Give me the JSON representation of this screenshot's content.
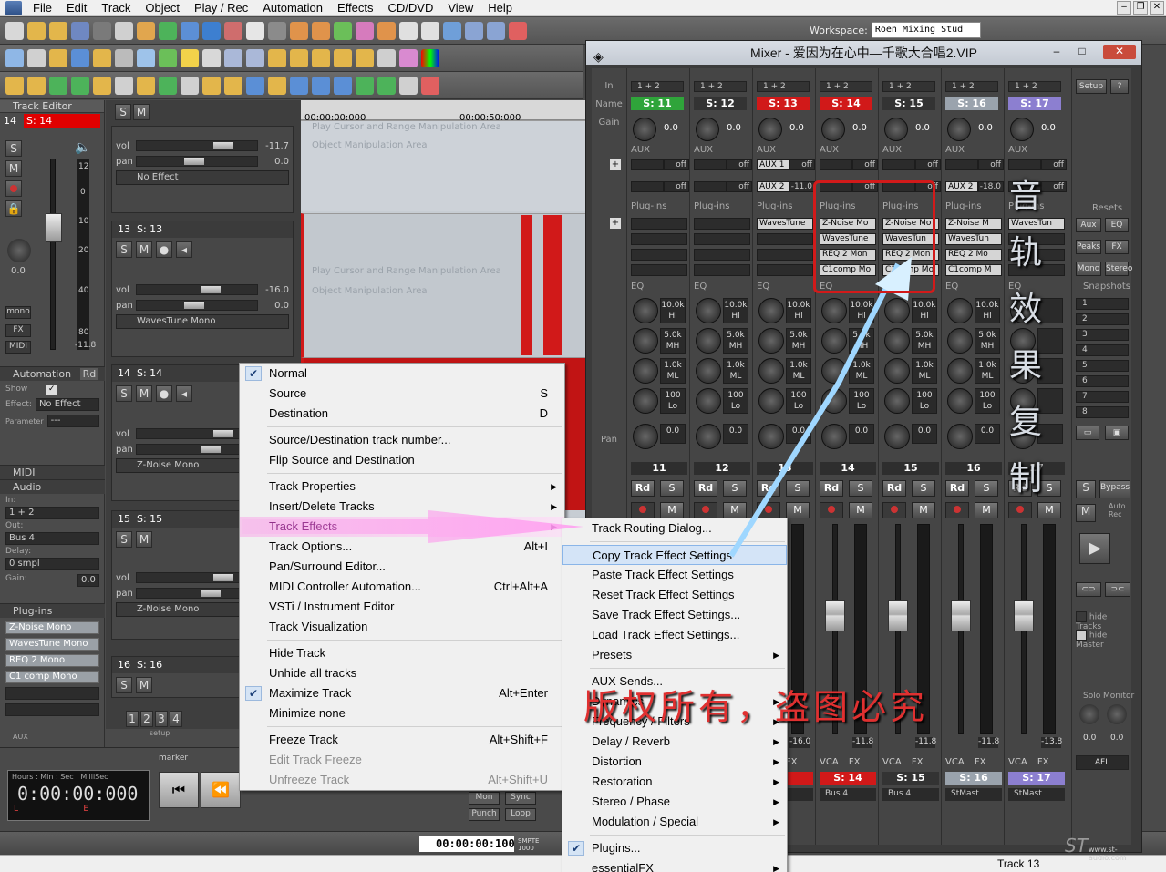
{
  "menubar": [
    "File",
    "Edit",
    "Track",
    "Object",
    "Play / Rec",
    "Automation",
    "Effects",
    "CD/DVD",
    "View",
    "Help"
  ],
  "workspace": {
    "label": "Workspace:",
    "value": "Roen Mixing Stud"
  },
  "track_editor": {
    "title": "Track Editor",
    "track_num": "14",
    "track_name": "S: 14",
    "meter_ticks": [
      "12",
      "0",
      "10",
      "20",
      "40",
      "80",
      "-11.8"
    ],
    "pan_val": "0.0",
    "buttons": {
      "mono": "mono",
      "fx": "FX",
      "midi": "MIDI"
    },
    "automation": {
      "title": "Automation",
      "rd": "Rd",
      "show": "Show",
      "effect_label": "Effect:",
      "effect_value": "No Effect",
      "param_label": "Parameter",
      "param_value": "---"
    },
    "midi": "MIDI",
    "audio": {
      "title": "Audio",
      "in_label": "In:",
      "in_value": "1 + 2",
      "out_label": "Out:",
      "out_value": "Bus 4",
      "delay_label": "Delay:",
      "delay_value": "0 smpl",
      "gain_label": "Gain:",
      "gain_value": "0.0"
    },
    "plugins": {
      "title": "Plug-ins",
      "items": [
        "Z-Noise Mono",
        "WavesTune Mono",
        "REQ 2 Mono",
        "C1 comp Mono"
      ]
    },
    "aux_label": "AUX"
  },
  "tracks_header": {
    "s": "S",
    "m": "M"
  },
  "tracks": [
    {
      "vol": "-11.7",
      "pan": "0.0",
      "fx": "No Effect"
    },
    {
      "num": "13",
      "name": "S: 13",
      "vol": "-16.0",
      "pan": "0.0",
      "fx": "WavesTune Mono"
    },
    {
      "num": "14",
      "name": "S: 14",
      "vol": "",
      "pan": "",
      "fx": "Z-Noise Mono"
    },
    {
      "num": "15",
      "name": "S: 15",
      "vol": "",
      "pan": "",
      "fx": "Z-Noise Mono"
    },
    {
      "num": "16",
      "name": "S: 16"
    }
  ],
  "ruler": {
    "t1": "00:00:00:000",
    "t2": "00:00:50:000"
  },
  "clip_texts": {
    "a": "Play Cursor and Range Manipulation Area",
    "b": "Object Manipulation Area"
  },
  "setup_nums": [
    "1",
    "2",
    "3",
    "4"
  ],
  "setup_label": "setup",
  "transport": {
    "time_caption": "Hours : Min : Sec : MilliSec",
    "time": "0:00:00:000",
    "L": "L",
    "E": "E",
    "marker": "marker",
    "punch": "Punch",
    "loop": "Loop",
    "sync": "Sync",
    "mon": "Mon",
    "time2": "00:00:00:100",
    "smpte": "SMPTE 1000"
  },
  "statusbar": {
    "track": "Track 13"
  },
  "mixer": {
    "title": "Mixer - 爱因为在心中—千歌大合唱2.VIP",
    "labels": {
      "in": "In",
      "name": "Name",
      "gain": "Gain",
      "aux": "AUX",
      "plugins": "Plug-ins",
      "eq": "EQ",
      "pan": "Pan"
    },
    "strips": [
      {
        "in": "1 + 2",
        "name": "S: 11",
        "num": "11",
        "color": "#2fa43a",
        "aux1": "off",
        "aux2": "off",
        "plugins": [
          "",
          "",
          "",
          ""
        ],
        "eq": [
          "10.0k Hi",
          "5.0k MH",
          "1.0k ML",
          "100 Lo"
        ],
        "pan": "0.0",
        "meter": "",
        "bot": "",
        "bus": ""
      },
      {
        "in": "1 + 2",
        "name": "S: 12",
        "num": "12",
        "color": "#333333",
        "aux1": "off",
        "aux2": "off",
        "plugins": [
          "",
          "",
          "",
          ""
        ],
        "eq": [
          "10.0k Hi",
          "5.0k MH",
          "1.0k ML",
          "100 Lo"
        ],
        "pan": "0.0",
        "meter": "",
        "bot": "",
        "bus": ""
      },
      {
        "in": "1 + 2",
        "name": "S: 13",
        "num": "13",
        "color": "#d11919",
        "aux1n": "AUX 1",
        "aux1": "off",
        "aux2n": "AUX 2",
        "aux2": "-11.0",
        "plugins": [
          "WavesTune",
          "",
          "",
          ""
        ],
        "eq": [
          "10.0k Hi",
          "5.0k MH",
          "1.0k ML",
          "100 Lo"
        ],
        "pan": "0.0",
        "meter": "-16.0",
        "bot": "3",
        "bus": ""
      },
      {
        "in": "1 + 2",
        "name": "S: 14",
        "num": "14",
        "color": "#d11919",
        "aux1": "off",
        "aux2": "off",
        "plugins": [
          "Z-Noise Mo",
          "WavesTune",
          "REQ 2 Mon",
          "C1comp Mo"
        ],
        "eq": [
          "10.0k Hi",
          "5.0k MH",
          "1.0k ML",
          "100 Lo"
        ],
        "pan": "0.0",
        "meter": "-11.8",
        "bot": "S: 14",
        "bus": "Bus 4"
      },
      {
        "in": "1 + 2",
        "name": "S: 15",
        "num": "15",
        "color": "#333333",
        "aux1": "off",
        "aux2": "off",
        "plugins": [
          "Z-Noise Mo",
          "WavesTun",
          "REQ 2 Mon",
          "C1comp Mo"
        ],
        "eq": [
          "10.0k Hi",
          "5.0k MH",
          "1.0k ML",
          "100 Lo"
        ],
        "pan": "0.0",
        "meter": "-11.8",
        "bot": "S: 15",
        "bus": "Bus 4"
      },
      {
        "in": "1 + 2",
        "name": "S: 16",
        "num": "16",
        "color": "#9aa3ad",
        "aux1": "off",
        "aux2n": "AUX 2",
        "aux2": "-18.0",
        "plugins": [
          "Z-Noise M",
          "WavesTun",
          "REQ 2 Mo",
          "C1comp M"
        ],
        "eq": [
          "10.0k Hi",
          "5.0k MH",
          "1.0k ML",
          "100 Lo"
        ],
        "pan": "0.0",
        "meter": "-11.8",
        "bot": "S: 16",
        "bus": "StMast"
      },
      {
        "in": "1 + 2",
        "name": "S: 17",
        "num": "17",
        "color": "#8c7fd0",
        "aux1": "off",
        "aux2": "off",
        "plugins": [
          "WavesTun",
          "",
          "",
          ""
        ],
        "eq": [
          "",
          "",
          "",
          ""
        ],
        "pan": "",
        "meter": "-13.8",
        "bot": "S: 17",
        "bus": "StMast"
      }
    ],
    "right": {
      "setup": "Setup",
      "help": "?",
      "resets": "Resets",
      "aux": "Aux",
      "eq": "EQ",
      "peaks": "Peaks",
      "fx": "FX",
      "mono": "Mono",
      "stereo": "Stereo",
      "snapshots": "Snapshots",
      "snaps": [
        "1",
        "2",
        "3",
        "4",
        "5",
        "6",
        "7",
        "8"
      ],
      "s": "S",
      "bypass": "Bypass",
      "m": "M",
      "autorec": "Auto Rec",
      "hide_tracks": "hide Tracks",
      "hide_master": "hide Master",
      "solo": "Solo",
      "monitor": "Monitor",
      "afl": "AFL",
      "solo_val": "0.0",
      "mon_val": "0.0"
    },
    "vca": "VCA",
    "fx": "FX",
    "rd": "Rd",
    "s": "S",
    "m": "M"
  },
  "context_menu": [
    {
      "label": "Normal",
      "checked": true
    },
    {
      "label": "Source",
      "shortcut": "S"
    },
    {
      "label": "Destination",
      "shortcut": "D"
    },
    {
      "sep": true
    },
    {
      "label": "Source/Destination track number..."
    },
    {
      "label": "Flip Source and Destination"
    },
    {
      "sep": true
    },
    {
      "label": "Track Properties",
      "sub": true
    },
    {
      "label": "Insert/Delete Tracks",
      "sub": true
    },
    {
      "label": "Track Effects",
      "sub": true,
      "pink": true
    },
    {
      "label": "Track Options...",
      "shortcut": "Alt+I"
    },
    {
      "label": "Pan/Surround Editor..."
    },
    {
      "label": "MIDI Controller Automation...",
      "shortcut": "Ctrl+Alt+A"
    },
    {
      "label": "VSTi / Instrument Editor"
    },
    {
      "label": "Track Visualization"
    },
    {
      "sep": true
    },
    {
      "label": "Hide Track"
    },
    {
      "label": "Unhide all tracks"
    },
    {
      "label": "Maximize Track",
      "shortcut": "Alt+Enter",
      "checked": true
    },
    {
      "label": "Minimize none"
    },
    {
      "sep": true
    },
    {
      "label": "Freeze Track",
      "shortcut": "Alt+Shift+F"
    },
    {
      "label": "Edit Track Freeze",
      "disabled": true
    },
    {
      "label": "Unfreeze Track",
      "shortcut": "Alt+Shift+U",
      "disabled": true
    }
  ],
  "sub_menu": [
    {
      "label": "Track Routing Dialog..."
    },
    {
      "sep": true
    },
    {
      "label": "Copy Track Effect Settings",
      "hl": true
    },
    {
      "label": "Paste Track Effect Settings"
    },
    {
      "label": "Reset Track Effect Settings"
    },
    {
      "label": "Save Track Effect Settings..."
    },
    {
      "label": "Load Track Effect Settings..."
    },
    {
      "label": "Presets",
      "sub": true
    },
    {
      "sep": true
    },
    {
      "label": "AUX Sends..."
    },
    {
      "label": "Dynamics",
      "sub": true
    },
    {
      "label": "Frequency / Filters",
      "sub": true
    },
    {
      "label": "Delay / Reverb",
      "sub": true
    },
    {
      "label": "Distortion",
      "sub": true
    },
    {
      "label": "Restoration",
      "sub": true
    },
    {
      "label": "Stereo / Phase",
      "sub": true
    },
    {
      "label": "Modulation / Special",
      "sub": true
    },
    {
      "sep": true
    },
    {
      "label": "Plugins...",
      "checked": true
    },
    {
      "label": "essentialFX",
      "sub": true
    }
  ],
  "annotations": {
    "vertical": "音轨效果复制",
    "watermark": "版权所有，盗图必究",
    "logo": "www.st-audio.com"
  },
  "colors": {
    "accent_red": "#d11919",
    "menu_bg": "#f0f0f0",
    "highlight": "#d4e4f7"
  }
}
